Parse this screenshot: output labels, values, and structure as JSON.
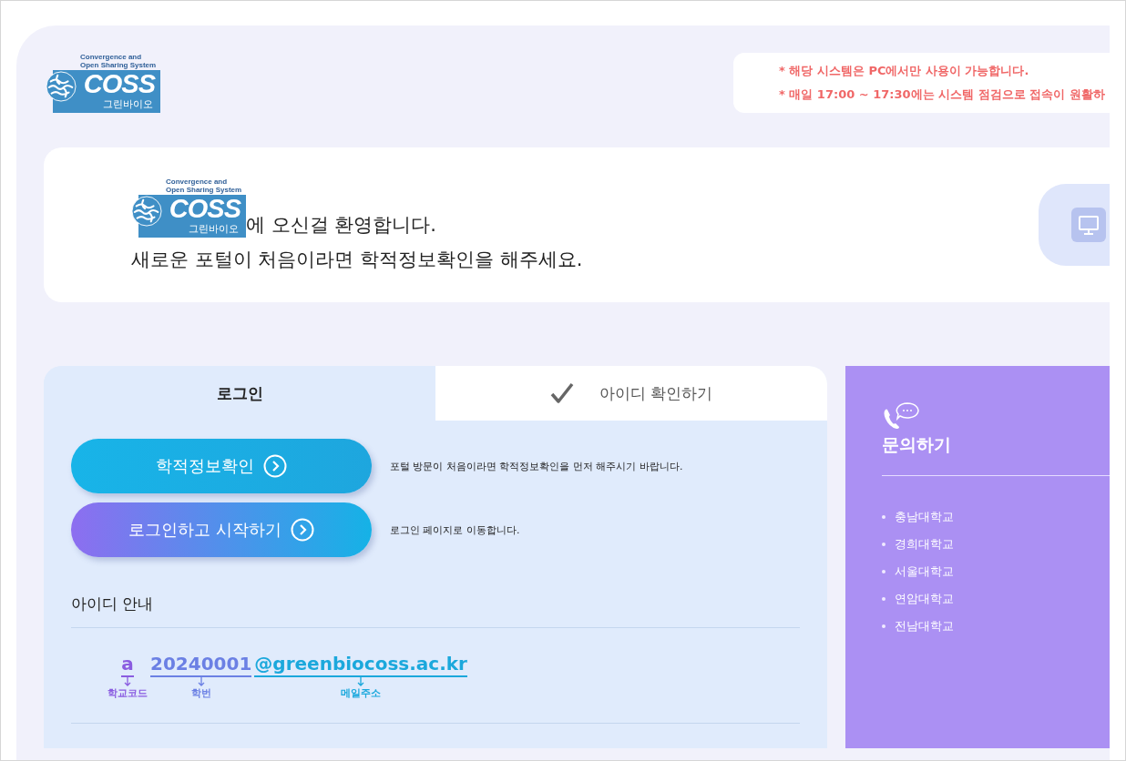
{
  "header": {
    "logo": {
      "tagline": "Convergence and Open Sharing System",
      "wordmark": "COSS",
      "subtitle": "그린바이오"
    },
    "notices": [
      "* 해당 시스템은 PC에서만 사용이 가능합니다.",
      "* 매일 17:00 ~ 17:30에는 시스템 점검으로 접속이 원활하"
    ]
  },
  "welcome": {
    "logo": {
      "tagline": "Convergence and Open Sharing System",
      "wordmark": "COSS",
      "subtitle": "그린바이오"
    },
    "line1": "에 오신걸 환영합니다.",
    "line2": "새로운 포털이 처음이라면 학적정보확인을 해주세요."
  },
  "tabs": [
    {
      "label": "로그인",
      "selected": true,
      "kind": "plain"
    },
    {
      "label": "아이디 확인하기",
      "selected": false,
      "kind": "check"
    }
  ],
  "actions": [
    {
      "label": "학적정보확인",
      "description": "포털 방문이 처음이라면 학적정보확인을 먼저 해주시기 바랍니다.",
      "kind": "primary"
    },
    {
      "label": "로그인하고 시작하기",
      "description": "로그인 페이지로 이동합니다.",
      "kind": "secondary"
    }
  ],
  "id_guide": {
    "title": "아이디 안내",
    "parts": [
      {
        "text": "a",
        "caption": "학교코드",
        "color": "#8a5ce0"
      },
      {
        "text": "20240001",
        "caption": "학번",
        "color": "#6b80e4"
      },
      {
        "text": "@greenbiocoss.ac.kr",
        "caption": "메일주소",
        "color": "#1ba8dc"
      }
    ]
  },
  "contact": {
    "title": "문의하기",
    "items": [
      "충남대학교",
      "경희대학교",
      "서울대학교",
      "연암대학교",
      "전남대학교"
    ]
  }
}
